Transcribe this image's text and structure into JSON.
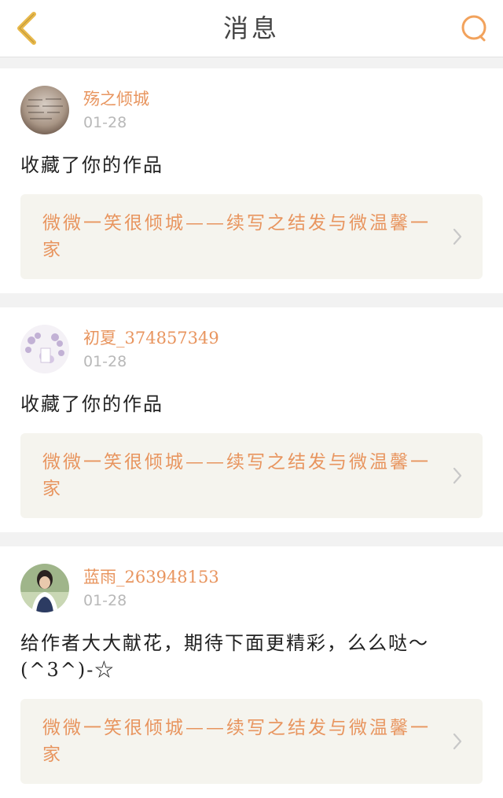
{
  "header": {
    "title": "消息",
    "back_icon": "chevron-left-icon",
    "search_icon": "search-icon",
    "accent": "#e8b84a"
  },
  "messages": [
    {
      "username": "殇之倾城",
      "date": "01-28",
      "text": "收藏了你的作品",
      "work_title": "微微一笑很倾城——续写之结发与微温馨一家"
    },
    {
      "username": "初夏_374857349",
      "date": "01-28",
      "text": "收藏了你的作品",
      "work_title": "微微一笑很倾城——续写之结发与微温馨一家"
    },
    {
      "username": "蓝雨_263948153",
      "date": "01-28",
      "text": "给作者大大献花，期待下面更精彩，么么哒～(^3^)-☆",
      "work_title": "微微一笑很倾城——续写之结发与微温馨一家"
    }
  ],
  "colors": {
    "username": "#e8955f",
    "link_bg": "#f5f4ee",
    "date": "#b8b8b8"
  }
}
